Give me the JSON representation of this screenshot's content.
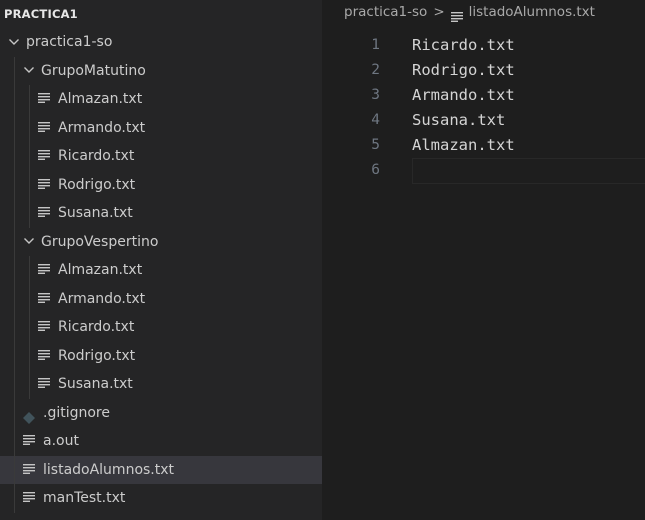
{
  "explorer": {
    "root_label": "PRACTICA1",
    "tree": [
      {
        "type": "folder",
        "label": "practica1-so",
        "depth": 0,
        "expanded": true
      },
      {
        "type": "folder",
        "label": "GrupoMatutino",
        "depth": 1,
        "expanded": true
      },
      {
        "type": "file",
        "label": "Almazan.txt",
        "depth": 2
      },
      {
        "type": "file",
        "label": "Armando.txt",
        "depth": 2
      },
      {
        "type": "file",
        "label": "Ricardo.txt",
        "depth": 2
      },
      {
        "type": "file",
        "label": "Rodrigo.txt",
        "depth": 2
      },
      {
        "type": "file",
        "label": "Susana.txt",
        "depth": 2
      },
      {
        "type": "folder",
        "label": "GrupoVespertino",
        "depth": 1,
        "expanded": true
      },
      {
        "type": "file",
        "label": "Almazan.txt",
        "depth": 2
      },
      {
        "type": "file",
        "label": "Armando.txt",
        "depth": 2
      },
      {
        "type": "file",
        "label": "Ricardo.txt",
        "depth": 2
      },
      {
        "type": "file",
        "label": "Rodrigo.txt",
        "depth": 2
      },
      {
        "type": "file",
        "label": "Susana.txt",
        "depth": 2
      },
      {
        "type": "gitignore",
        "label": ".gitignore",
        "depth": 1
      },
      {
        "type": "file",
        "label": "a.out",
        "depth": 1
      },
      {
        "type": "file",
        "label": "listadoAlumnos.txt",
        "depth": 1,
        "selected": true
      },
      {
        "type": "file",
        "label": "manTest.txt",
        "depth": 1
      }
    ]
  },
  "breadcrumb": {
    "folder": "practica1-so",
    "separator": ">",
    "file": "listadoAlumnos.txt"
  },
  "editor": {
    "lines": [
      {
        "number": "1",
        "text": "Ricardo.txt"
      },
      {
        "number": "2",
        "text": "Rodrigo.txt"
      },
      {
        "number": "3",
        "text": "Armando.txt"
      },
      {
        "number": "4",
        "text": "Susana.txt"
      },
      {
        "number": "5",
        "text": "Almazan.txt"
      },
      {
        "number": "6",
        "text": "",
        "current": true
      }
    ]
  },
  "colors": {
    "sidebar_bg": "#252526",
    "editor_bg": "#1e1e1e",
    "selected_row_bg": "#37373d",
    "text": "#cccccc",
    "line_number": "#6e7681",
    "gitignore_icon": "#41535b"
  },
  "icons": {
    "folder_expanded": "chevron-down-icon",
    "text_file": "lines-file-icon",
    "gitignore": "git-diamond-icon"
  }
}
